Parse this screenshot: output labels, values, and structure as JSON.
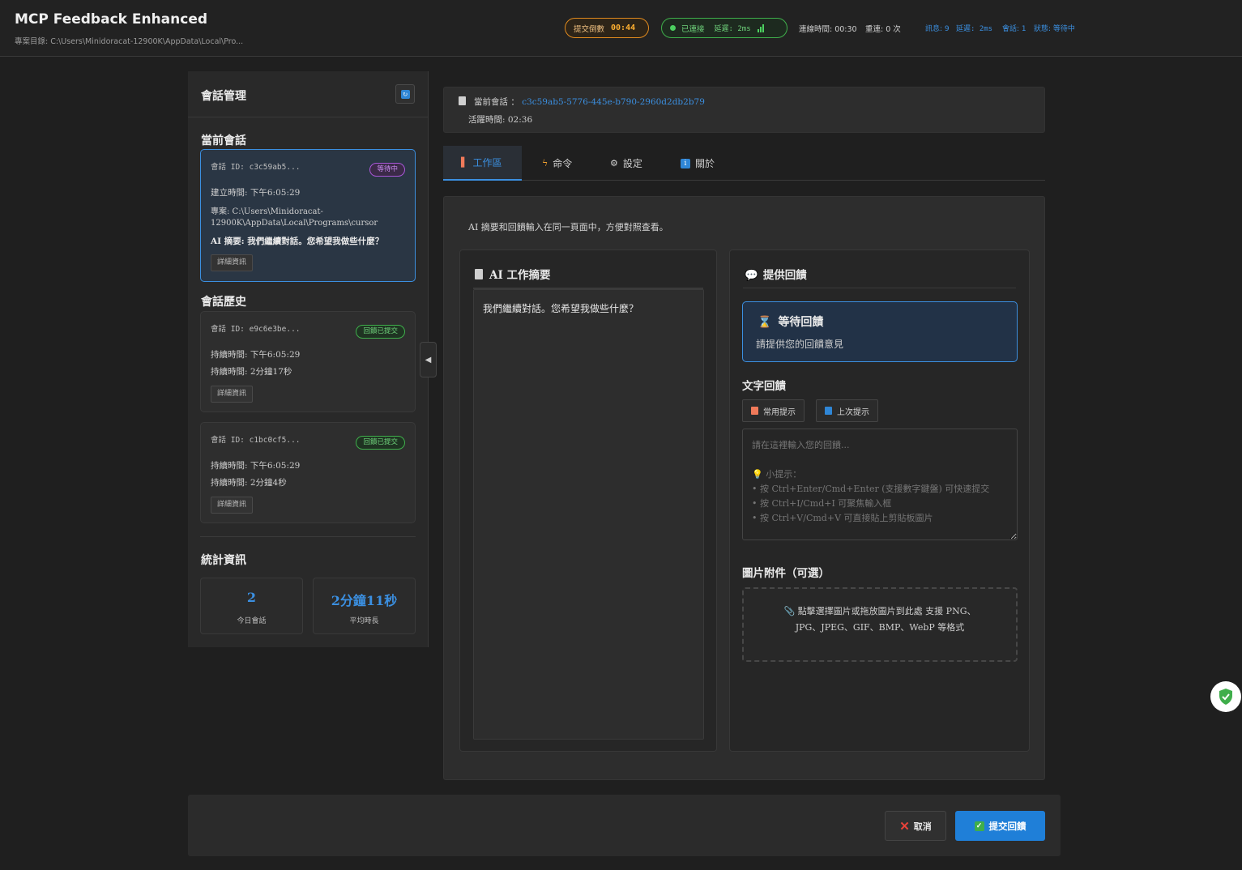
{
  "header": {
    "app_title": "MCP Feedback Enhanced",
    "project_dir": "專案目錄: C:\\Users\\Minidoracat-12900K\\AppData\\Local\\Pro...",
    "countdown_label": "提交倒數",
    "countdown_value": "00:44",
    "connection_label": "已連接",
    "latency_label": "延遲: 2ms",
    "connect_time": "連線時間: 00:30",
    "reconnect": "重連: 0 次",
    "messages": "訊息: 9",
    "latency2": "延遲: 2ms",
    "sessions": "會話: 1",
    "status": "狀態: 等待中"
  },
  "sidebar": {
    "title": "會話管理",
    "current_title": "當前會話",
    "current": {
      "id": "會話 ID: c3c59ab5...",
      "badge": "等待中",
      "created": "建立時間: 下午6:05:29",
      "project_1": "專案: C:\\Users\\Minidoracat-",
      "project_2": "12900K\\AppData\\Local\\Programs\\cursor",
      "summary": "AI 摘要: 我們繼續對話。您希望我做些什麼？",
      "detail": "詳細資訊"
    },
    "history_title": "會話歷史",
    "history": [
      {
        "id": "會話 ID: e9c6e3be...",
        "badge": "回饋已提交",
        "time": "持續時間: 下午6:05:29",
        "duration": "持續時間: 2分鐘17秒",
        "detail": "詳細資訊"
      },
      {
        "id": "會話 ID: c1bc0cf5...",
        "badge": "回饋已提交",
        "time": "持續時間: 下午6:05:29",
        "duration": "持續時間: 2分鐘4秒",
        "detail": "詳細資訊"
      }
    ],
    "stats_title": "統計資訊",
    "stats": [
      {
        "value": "2",
        "label": "今日會話"
      },
      {
        "value": "2分鐘11秒",
        "label": "平均時長"
      }
    ]
  },
  "session_info": {
    "label": "當前會話 ：",
    "id": "c3c59ab5-5776-445e-b790-2960d2db2b79",
    "active_time": "活躍時間: 02:36"
  },
  "tabs": [
    {
      "label": "工作區",
      "icon": "document-icon"
    },
    {
      "label": "命令",
      "icon": "lightning-icon"
    },
    {
      "label": "設定",
      "icon": "gear-icon"
    },
    {
      "label": "關於",
      "icon": "info-icon"
    }
  ],
  "workspace": {
    "description": "AI 摘要和回饋輸入在同一頁面中，方便對照查看。",
    "summary_title": "AI 工作摘要",
    "summary_text": "我們繼續對話。您希望我做些什麼？",
    "feedback_title": "提供回饋",
    "waiting_title": "等待回饋",
    "waiting_sub": "請提供您的回饋意見",
    "text_feedback_title": "文字回饋",
    "prompt_btn": "常用提示",
    "context_btn": "上次提示",
    "textarea_placeholder": "請在這裡輸入您的回饋...\n\n💡 小提示：\n• 按 Ctrl+Enter/Cmd+Enter (支援數字鍵盤) 可快速提交\n• 按 Ctrl+I/Cmd+I 可聚焦輸入框\n• 按 Ctrl+V/Cmd+V 可直接貼上剪貼板圖片",
    "image_title": "圖片附件（可選）",
    "dropzone_line1": "點擊選擇圖片或拖放圖片到此處 支援 PNG、",
    "dropzone_line2": "JPG、JPEG、GIF、BMP、WebP 等格式"
  },
  "footer": {
    "cancel": "取消",
    "submit": "提交回饋"
  },
  "colors": {
    "accent": "#3b8fe0",
    "success": "#3fae4b",
    "warning": "#e08a1e",
    "waiting": "#a957d8"
  }
}
